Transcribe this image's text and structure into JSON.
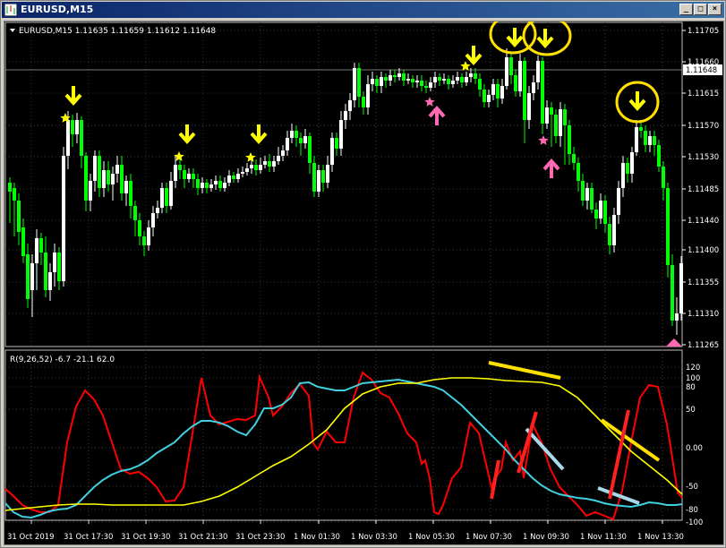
{
  "window": {
    "title": "EURUSD,M15",
    "buttons": {
      "minimize": "_",
      "restore": "□",
      "close": "×"
    }
  },
  "main_chart": {
    "info": "EURUSD,M15  1.11635 1.11659 1.11612 1.11648",
    "current_price": "1.11648",
    "price_ticks": [
      "1.11705",
      "1.11660",
      "1.11615",
      "1.11570",
      "1.11530",
      "1.11485",
      "1.11440",
      "1.11400",
      "1.11355",
      "1.11310",
      "1.11265"
    ]
  },
  "indicator": {
    "label": "R(9,26,52) -6.7 -21.1 62.0",
    "ticks": [
      "120",
      "100",
      "80",
      "50",
      "0.00",
      "-50",
      "-80",
      "-100"
    ]
  },
  "time_axis": [
    "31 Oct 2019",
    "31 Oct 17:30",
    "31 Oct 19:30",
    "31 Oct 21:30",
    "31 Oct 23:30",
    "1 Nov 01:30",
    "1 Nov 03:30",
    "1 Nov 05:30",
    "1 Nov 07:30",
    "1 Nov 09:30",
    "1 Nov 11:30",
    "1 Nov 13:30"
  ],
  "colors": {
    "bull_candle": "#ffffff",
    "bear_candle": "#00ff00",
    "sell_arrow": "#ffff00",
    "buy_arrow": "#ff69b4",
    "red_line": "#ff0000",
    "cyan_line": "#40d0e0",
    "yellow_line": "#ffff00",
    "annotation_yellow": "#ffe000",
    "annotation_red": "#ff2020",
    "annotation_lightblue": "#a8d8ea"
  }
}
